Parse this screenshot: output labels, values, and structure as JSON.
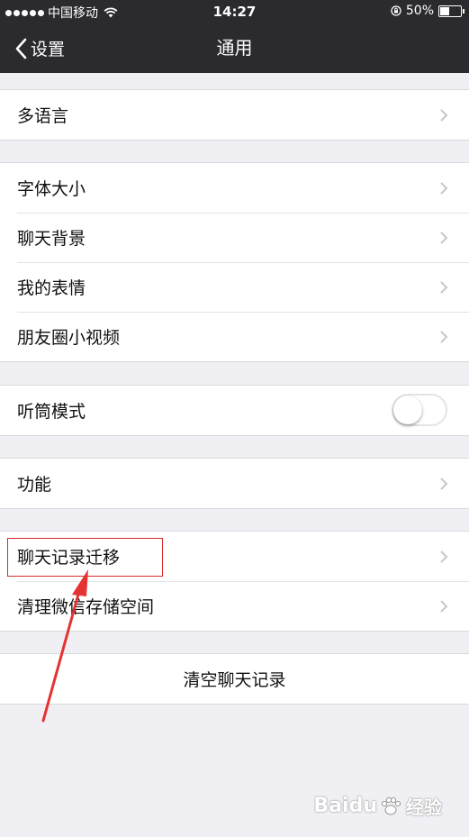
{
  "status_bar": {
    "carrier": "中国移动",
    "time": "14:27",
    "battery": "50%",
    "battery_level": 0.5,
    "signal_bars": 5
  },
  "nav": {
    "back_label": "设置",
    "title": "通用"
  },
  "groups": [
    {
      "items": [
        {
          "label": "多语言",
          "control": "chevron"
        }
      ]
    },
    {
      "items": [
        {
          "label": "字体大小",
          "control": "chevron"
        },
        {
          "label": "聊天背景",
          "control": "chevron"
        },
        {
          "label": "我的表情",
          "control": "chevron"
        },
        {
          "label": "朋友圈小视频",
          "control": "chevron"
        }
      ]
    },
    {
      "items": [
        {
          "label": "听筒模式",
          "control": "toggle",
          "toggle_on": false
        }
      ]
    },
    {
      "items": [
        {
          "label": "功能",
          "control": "chevron"
        }
      ]
    },
    {
      "items": [
        {
          "label": "聊天记录迁移",
          "control": "chevron"
        },
        {
          "label": "清理微信存储空间",
          "control": "chevron"
        }
      ]
    }
  ],
  "clear_button": {
    "label": "清空聊天记录"
  },
  "annotation": {
    "highlight_color": "#d82b2b"
  },
  "watermark": {
    "brand": "Baidu",
    "suffix": "经验"
  },
  "colors": {
    "nav_bg": "#2b2b2f",
    "page_bg": "#efeff4",
    "chevron": "#c7c7cc"
  }
}
